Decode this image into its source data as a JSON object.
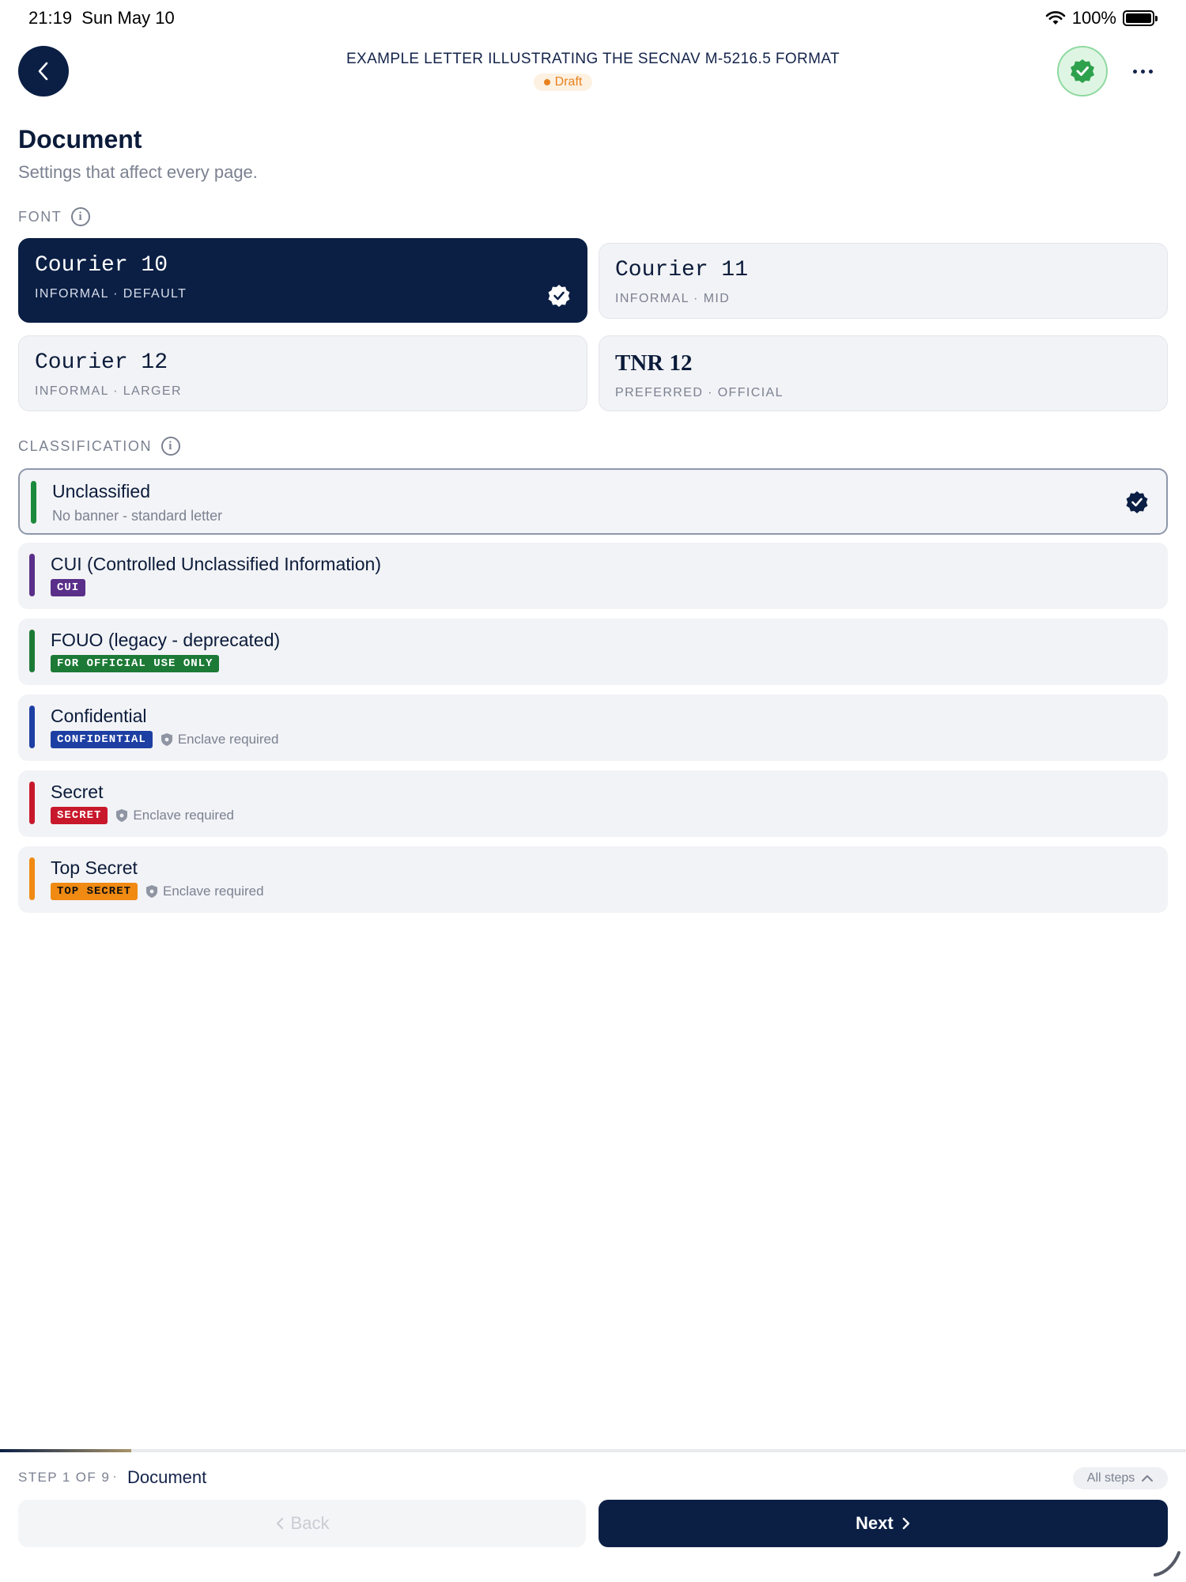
{
  "status_bar": {
    "time": "21:19",
    "date": "Sun May 10",
    "battery": "100%"
  },
  "header": {
    "title": "EXAMPLE LETTER ILLUSTRATING THE SECNAV M-5216.5 FORMAT",
    "status": "Draft"
  },
  "section": {
    "title": "Document",
    "subtitle": "Settings that affect every page."
  },
  "font_group": {
    "label": "FONT",
    "options": [
      {
        "name": "Courier 10",
        "meta": "INFORMAL · DEFAULT",
        "selected": true
      },
      {
        "name": "Courier 11",
        "meta": "INFORMAL · MID"
      },
      {
        "name": "Courier 12",
        "meta": "INFORMAL · LARGER"
      },
      {
        "name": "TNR 12",
        "meta": "PREFERRED · OFFICIAL"
      }
    ]
  },
  "classification_group": {
    "label": "CLASSIFICATION",
    "options": [
      {
        "title": "Unclassified",
        "subtitle": "No banner - standard letter",
        "color": "#1c8a3c",
        "selected": true
      },
      {
        "title": "CUI (Controlled Unclassified Information)",
        "badge": "CUI",
        "color": "#5a2f8a"
      },
      {
        "title": "FOUO (legacy - deprecated)",
        "badge": "FOR OFFICIAL USE ONLY",
        "color": "#1c7a36"
      },
      {
        "title": "Confidential",
        "badge": "CONFIDENTIAL",
        "note": "Enclave required",
        "color": "#1d3fa3"
      },
      {
        "title": "Secret",
        "badge": "SECRET",
        "note": "Enclave required",
        "color": "#c8182b"
      },
      {
        "title": "Top Secret",
        "badge": "TOP SECRET",
        "note": "Enclave required",
        "color": "#f08a12"
      }
    ]
  },
  "footer": {
    "step": "STEP 1 OF 9",
    "separator": "·",
    "step_name": "Document",
    "all_steps": "All steps",
    "back": "Back",
    "next": "Next",
    "progress": 0.111
  }
}
